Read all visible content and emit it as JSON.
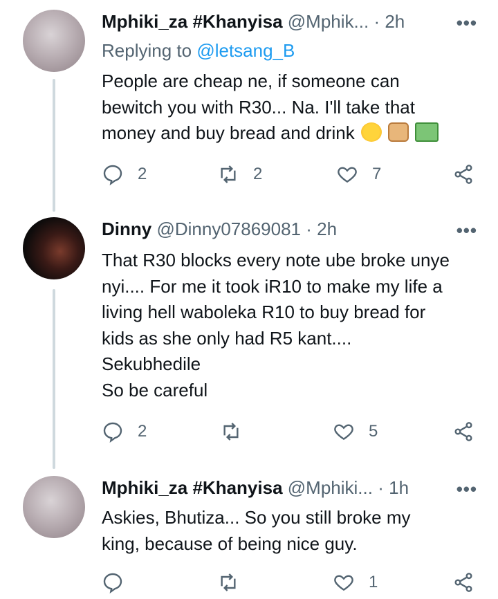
{
  "tweets": [
    {
      "name": "Mphiki_za #Khanyisa",
      "handle": "@Mphik...",
      "separator": "·",
      "time": "2h",
      "replying_prefix": "Replying to",
      "replying_to": "@letsang_B",
      "text_lines": [
        "People are cheap ne, if someone can",
        "bewitch you with R30... Na. I'll take that",
        "money and buy bread and drink"
      ],
      "emojis": [
        "joy-emoji",
        "bread-emoji",
        "money-emoji"
      ],
      "replies": "2",
      "retweets": "2",
      "likes": "7"
    },
    {
      "name": "Dinny",
      "handle": "@Dinny07869081",
      "separator": "·",
      "time": "2h",
      "text_lines": [
        "That R30 blocks every note ube broke unye",
        "nyi.... For me it took iR10 to make my life a",
        "living hell waboleka R10 to buy bread for",
        "kids as she only had R5 kant....",
        "Sekubhedile",
        "So be careful"
      ],
      "replies": "2",
      "retweets": "",
      "likes": "5"
    },
    {
      "name": "Mphiki_za #Khanyisa",
      "handle": "@Mphiki...",
      "separator": "·",
      "time": "1h",
      "text_lines": [
        "Askies, Bhutiza... So you still broke my",
        "king, because of being nice guy."
      ],
      "replies": "",
      "retweets": "",
      "likes": "1"
    }
  ],
  "more_label": "•••",
  "colors": {
    "text": "#0f1419",
    "secondary": "#536471",
    "link": "#1d9bf0",
    "thread": "#cfd9de"
  },
  "icons": [
    "reply-icon",
    "retweet-icon",
    "like-icon",
    "share-icon",
    "more-icon"
  ]
}
